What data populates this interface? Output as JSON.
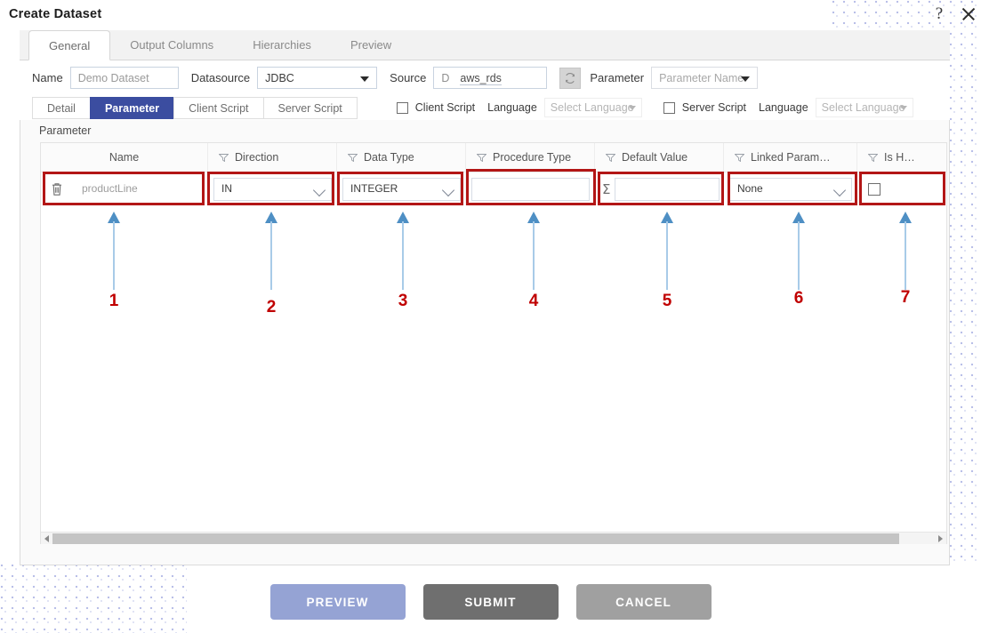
{
  "titlebar": {
    "title": "Create Dataset",
    "help_icon": "question-mark-icon",
    "close_icon": "close-icon"
  },
  "top_tabs": [
    {
      "label": "General",
      "active": true
    },
    {
      "label": "Output Columns",
      "active": false
    },
    {
      "label": "Hierarchies",
      "active": false
    },
    {
      "label": "Preview",
      "active": false
    }
  ],
  "form": {
    "name_label": "Name",
    "name_value": "Demo Dataset",
    "datasource_label": "Datasource",
    "datasource_value": "JDBC",
    "source_label": "Source",
    "source_prefix": "D",
    "source_value": "aws_rds",
    "refresh_icon": "refresh-icon",
    "parameter_label": "Parameter",
    "parameter_name_placeholder": "Parameter Name"
  },
  "inner_tabs": [
    {
      "label": "Detail",
      "active": false
    },
    {
      "label": "Parameter",
      "active": true
    },
    {
      "label": "Client Script",
      "active": false
    },
    {
      "label": "Server Script",
      "active": false
    }
  ],
  "scripts": {
    "client": {
      "checkbox_checked": false,
      "label": "Client Script",
      "language_label": "Language",
      "language_placeholder": "Select Language"
    },
    "server": {
      "checkbox_checked": false,
      "label": "Server Script",
      "language_label": "Language",
      "language_placeholder": "Select Language"
    }
  },
  "parameter_section_label": "Parameter",
  "grid": {
    "columns": [
      {
        "title": "Name",
        "filter": true
      },
      {
        "title": "Direction",
        "filter": true
      },
      {
        "title": "Data Type",
        "filter": true
      },
      {
        "title": "Procedure Type",
        "filter": true
      },
      {
        "title": "Default Value",
        "filter": true
      },
      {
        "title": "Linked Param…",
        "filter": true
      },
      {
        "title": "Is H…",
        "filter": true
      }
    ],
    "row": {
      "delete_icon": "trash-icon",
      "name_value": "productLine",
      "direction_value": "IN",
      "data_type_value": "INTEGER",
      "procedure_type_value": "",
      "default_value_icon": "Σ",
      "default_value": "",
      "linked_param_value": "None",
      "is_hidden_checked": false
    }
  },
  "annotations": {
    "accent_color": "#b31616",
    "arrow_color": "#4e8fc4",
    "numbers": [
      "1",
      "2",
      "3",
      "4",
      "5",
      "6",
      "7"
    ]
  },
  "footer": {
    "preview_label": "PREVIEW",
    "submit_label": "SUBMIT",
    "cancel_label": "CANCEL",
    "preview_color": "#95a3d4",
    "submit_color": "#6f6f6f",
    "cancel_color": "#a0a0a0"
  }
}
